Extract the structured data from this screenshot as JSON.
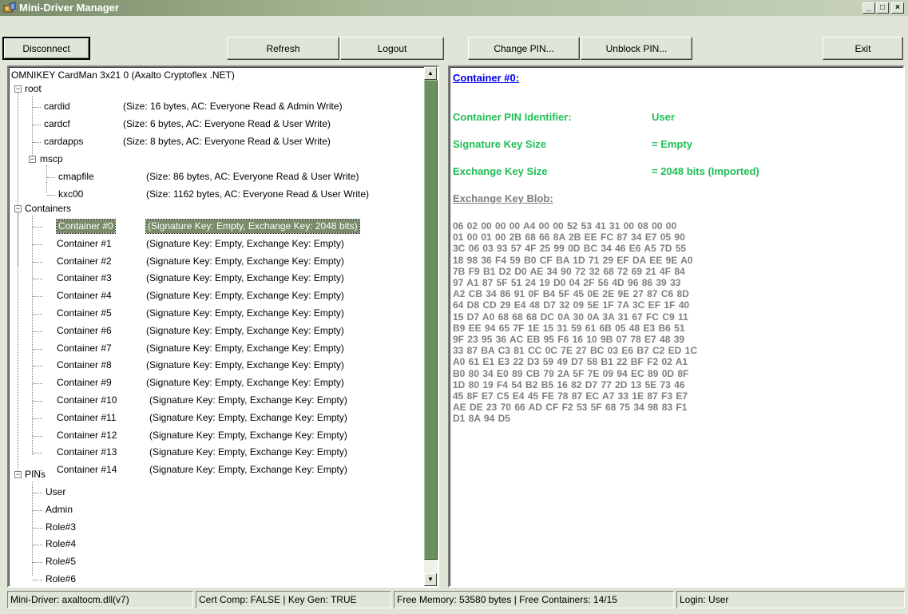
{
  "window": {
    "title": "Mini-Driver Manager"
  },
  "toolbar": {
    "disconnect": "Disconnect",
    "refresh": "Refresh",
    "logout": "Logout",
    "change_pin": "Change PIN...",
    "unblock_pin": "Unblock PIN...",
    "exit": "Exit"
  },
  "tree": {
    "reader": "OMNIKEY CardMan 3x21 0 (Axalto Cryptoflex .NET)",
    "root_label": "root",
    "root_files": [
      {
        "name": "cardid",
        "info": "(Size: 16 bytes, AC: Everyone Read & Admin Write)"
      },
      {
        "name": "cardcf",
        "info": "(Size: 6 bytes, AC: Everyone Read & User Write)"
      },
      {
        "name": "cardapps",
        "info": "(Size: 8 bytes, AC: Everyone Read & User Write)"
      }
    ],
    "mscp_label": "mscp",
    "mscp_files": [
      {
        "name": "cmapfile",
        "info": "(Size: 86 bytes, AC: Everyone Read & User Write)"
      },
      {
        "name": "kxc00",
        "info": "(Size: 1162 bytes, AC: Everyone Read & User Write)"
      }
    ],
    "containers_label": "Containers",
    "containers": [
      {
        "name": "Container #0",
        "info": "(Signature Key: Empty, Exchange Key: 2048 bits)"
      },
      {
        "name": "Container #1",
        "info": "(Signature Key: Empty, Exchange Key: Empty)"
      },
      {
        "name": "Container #2",
        "info": "(Signature Key: Empty, Exchange Key: Empty)"
      },
      {
        "name": "Container #3",
        "info": "(Signature Key: Empty, Exchange Key: Empty)"
      },
      {
        "name": "Container #4",
        "info": "(Signature Key: Empty, Exchange Key: Empty)"
      },
      {
        "name": "Container #5",
        "info": "(Signature Key: Empty, Exchange Key: Empty)"
      },
      {
        "name": "Container #6",
        "info": "(Signature Key: Empty, Exchange Key: Empty)"
      },
      {
        "name": "Container #7",
        "info": "(Signature Key: Empty, Exchange Key: Empty)"
      },
      {
        "name": "Container #8",
        "info": "(Signature Key: Empty, Exchange Key: Empty)"
      },
      {
        "name": "Container #9",
        "info": "(Signature Key: Empty, Exchange Key: Empty)"
      },
      {
        "name": "Container #10",
        "info": "(Signature Key: Empty, Exchange Key: Empty)"
      },
      {
        "name": "Container #11",
        "info": "(Signature Key: Empty, Exchange Key: Empty)"
      },
      {
        "name": "Container #12",
        "info": "(Signature Key: Empty, Exchange Key: Empty)"
      },
      {
        "name": "Container #13",
        "info": "(Signature Key: Empty, Exchange Key: Empty)"
      },
      {
        "name": "Container #14",
        "info": "(Signature Key: Empty, Exchange Key: Empty)"
      }
    ],
    "pins_label": "PINs",
    "pins": [
      "User",
      "Admin",
      "Role#3",
      "Role#4",
      "Role#5",
      "Role#6"
    ]
  },
  "details": {
    "heading": "Container #0:",
    "pin_identifier_label": "Container PIN Identifier:",
    "pin_identifier_value": "User",
    "sig_size_label": "Signature Key Size",
    "sig_size_value": "= Empty",
    "exch_size_label": "Exchange Key Size",
    "exch_size_value": "= 2048 bits (Imported)",
    "blob_label": "Exchange Key Blob:",
    "blob": "06 02 00 00 00 A4 00 00 52 53 41 31 00 08 00 00\n01 00 01 00 2B 68 66 8A 2B EE FC 87 34 E7 05 90\n3C 06 03 93 57 4F 25 99 0D BC 34 46 E6 A5 7D 55\n18 98 36 F4 59 B0 CF BA 1D 71 29 EF DA EE 9E A0\n7B F9 B1 D2 D0 AE 34 90 72 32 68 72 69 21 4F 84\n97 A1 87 5F 51 24 19 D0 04 2F 56 4D 96 86 39 33\nA2 CB 34 86 91 0F B4 5F 45 0E 2E 9E 27 87 C6 8D\n64 D8 CD 29 E4 48 D7 32 09 5E 1F 7A 3C EF 1F 40\n15 D7 A0 68 68 68 DC 0A 30 0A 3A 31 67 FC C9 11\nB9 EE 94 65 7F 1E 15 31 59 61 6B 05 48 E3 B6 51\n9F 23 95 36 AC EB 95 F6 16 10 9B 07 78 E7 48 39\n33 87 BA C3 81 CC 0C 7E 27 BC 03 E6 B7 C2 ED 1C\nA0 61 E1 E3 22 D3 59 49 D7 58 B1 22 BF F2 02 A1\nB0 80 34 E0 89 CB 79 2A 5F 7E 09 94 EC 89 0D 8F\n1D 80 19 F4 54 B2 B5 16 82 D7 77 2D 13 5E 73 46\n45 8F E7 C5 E4 45 FE 78 87 EC A7 33 1E 87 F3 E7\nAE DE 23 70 66 AD CF F2 53 5F 68 75 34 98 83 F1\nD1 8A 94 D5"
  },
  "status": {
    "driver": "Mini-Driver: axaltocm.dll(v7)",
    "cert": "Cert Comp: FALSE | Key Gen: TRUE",
    "memory": "Free Memory: 53580 bytes | Free Containers: 14/15",
    "login": "Login: User"
  }
}
